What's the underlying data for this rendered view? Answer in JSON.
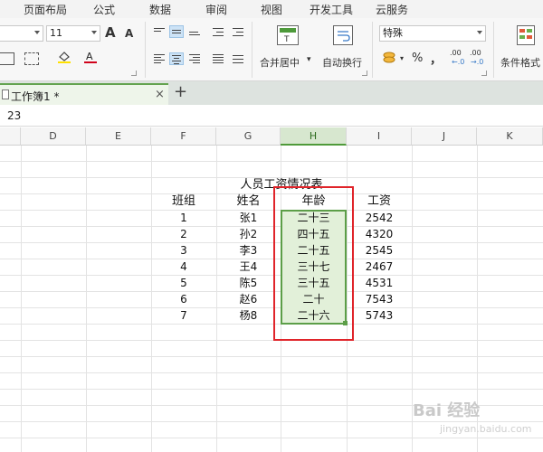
{
  "menu": {
    "tabs": [
      "页面布局",
      "公式",
      "数据",
      "审阅",
      "视图",
      "开发工具",
      "云服务"
    ]
  },
  "ribbon": {
    "font_size": "11",
    "font_grow": "A",
    "font_shrink": "A",
    "merge_center_label": "合并居中",
    "wrap_text_label": "自动换行",
    "number_format": "特殊",
    "percent": "%",
    "comma": "，",
    "increase_decimal": ".00",
    "decrease_decimal": ".00",
    "conditional_format_label": "条件格式",
    "font_color": "#d0021b",
    "fill_color": "#ffe100"
  },
  "document": {
    "tab_title": "工作簿1 *",
    "close": "×",
    "new_tab": "+"
  },
  "formula": {
    "value": "23"
  },
  "columns": [
    "D",
    "E",
    "F",
    "G",
    "H",
    "I",
    "J",
    "K"
  ],
  "table": {
    "title": "人员工资情况表",
    "headers": [
      "班组",
      "姓名",
      "年龄",
      "工资"
    ],
    "rows": [
      [
        "1",
        "张1",
        "二十三",
        "2542"
      ],
      [
        "2",
        "孙2",
        "四十五",
        "4320"
      ],
      [
        "3",
        "李3",
        "二十五",
        "2545"
      ],
      [
        "4",
        "王4",
        "三十七",
        "2467"
      ],
      [
        "5",
        "陈5",
        "三十五",
        "4531"
      ],
      [
        "6",
        "赵6",
        "二十",
        "7543"
      ],
      [
        "7",
        "杨8",
        "二十六",
        "5743"
      ]
    ]
  },
  "watermark": {
    "brand": "Bai  经验",
    "site": "jingyan.baidu.com"
  }
}
